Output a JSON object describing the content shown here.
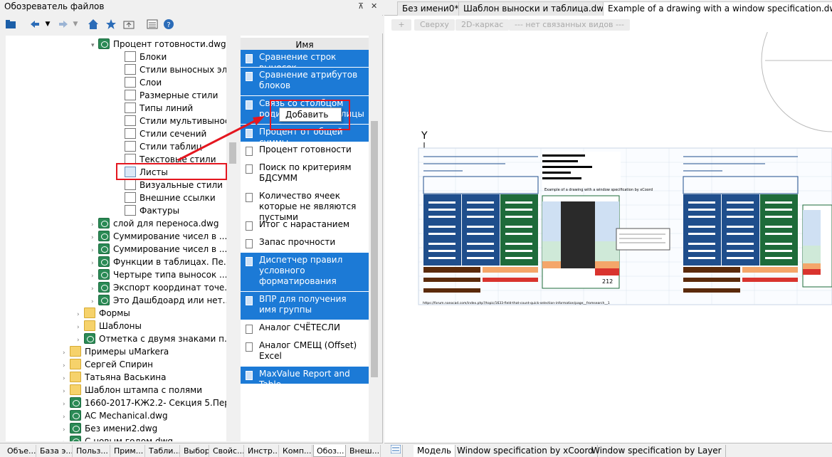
{
  "file_browser": {
    "title": "Обозреватель файлов",
    "pin_glyph": "⊼",
    "close_glyph": "✕"
  },
  "toolbar": {
    "icons": [
      "folder-icon",
      "back-icon",
      "forward-icon",
      "home-icon",
      "star-icon",
      "folder-up-icon",
      "view-icon",
      "help-icon"
    ]
  },
  "tree": [
    {
      "label": "Процент готовности.dwg",
      "icon": "dwg",
      "arrow": "▾",
      "indent": 128
    },
    {
      "label": "Блоки",
      "icon": "small",
      "indent": 165
    },
    {
      "label": "Стили выносных эл...",
      "icon": "small",
      "indent": 165
    },
    {
      "label": "Слои",
      "icon": "small",
      "indent": 165
    },
    {
      "label": "Размерные стили",
      "icon": "small",
      "indent": 165
    },
    {
      "label": "Типы линий",
      "icon": "small",
      "indent": 165
    },
    {
      "label": "Стили мультивыносок",
      "icon": "small",
      "indent": 165
    },
    {
      "label": "Стили сечений",
      "icon": "small",
      "indent": 165
    },
    {
      "label": "Стили таблиц",
      "icon": "small",
      "indent": 165
    },
    {
      "label": "Текстовые стили",
      "icon": "small",
      "indent": 165
    },
    {
      "label": "Листы",
      "icon": "sheet",
      "indent": 165
    },
    {
      "label": "Визуальные стили",
      "icon": "small",
      "indent": 165
    },
    {
      "label": "Внешние ссылки",
      "icon": "small",
      "indent": 165
    },
    {
      "label": "Фактуры",
      "icon": "small",
      "indent": 165
    },
    {
      "label": "слой для переноса.dwg",
      "icon": "dwg",
      "arrow": "›",
      "indent": 128
    },
    {
      "label": "Суммирование чисел в ...",
      "icon": "dwg",
      "arrow": "›",
      "indent": 128
    },
    {
      "label": "Суммирование чисел в ...",
      "icon": "dwg",
      "arrow": "›",
      "indent": 128
    },
    {
      "label": "Функции в таблицах. Пе...",
      "icon": "dwg",
      "arrow": "›",
      "indent": 128
    },
    {
      "label": "Чертыре типа выносок ...",
      "icon": "dwg",
      "arrow": "›",
      "indent": 128
    },
    {
      "label": "Экспорт координат точе...",
      "icon": "dwg",
      "arrow": "›",
      "indent": 128
    },
    {
      "label": "Это Дашбдоард или нет...",
      "icon": "dwg",
      "arrow": "›",
      "indent": 128
    },
    {
      "label": "Формы",
      "icon": "folder",
      "arrow": "›",
      "indent": 108
    },
    {
      "label": "Шаблоны",
      "icon": "folder",
      "arrow": "›",
      "indent": 108
    },
    {
      "label": "Отметка с двумя знаками п...",
      "icon": "dwg",
      "arrow": "›",
      "indent": 108
    },
    {
      "label": "Примеры uMarkera",
      "icon": "folder",
      "arrow": "›",
      "indent": 88
    },
    {
      "label": "Сергей Спирин",
      "icon": "folder",
      "arrow": "›",
      "indent": 88
    },
    {
      "label": "Татьяна Васькина",
      "icon": "folder",
      "arrow": "›",
      "indent": 88
    },
    {
      "label": "Шаблон штампа с полями",
      "icon": "folder",
      "arrow": "›",
      "indent": 88
    },
    {
      "label": "1660-2017-КЖ2.2- Секция 5.Пер...",
      "icon": "dwg",
      "arrow": "›",
      "indent": 88
    },
    {
      "label": "AC Mechanical.dwg",
      "icon": "dwg",
      "arrow": "›",
      "indent": 88
    },
    {
      "label": "Без имени2.dwg",
      "icon": "dwg",
      "arrow": "›",
      "indent": 88
    },
    {
      "label": "С новым годом.dwg",
      "icon": "dwg",
      "arrow": "›",
      "indent": 88
    }
  ],
  "list": {
    "header": "Имя",
    "items": [
      {
        "label": "Сравнение строк выносок",
        "selected": true,
        "lines": 1
      },
      {
        "label": "Сравнение атрибутов блоков",
        "selected": true,
        "lines": 2
      },
      {
        "label": "Связь со столбцом родительской таблицы",
        "selected": true,
        "lines": 2
      },
      {
        "label": "Процент от общей суммы",
        "selected": true,
        "lines": 1
      },
      {
        "label": "Процент готовности",
        "selected": false,
        "lines": 1
      },
      {
        "label": "Поиск по критериям БДСУММ",
        "selected": false,
        "lines": 2
      },
      {
        "label": "Количество ячеек которые не являются пустыми",
        "selected": false,
        "lines": 2
      },
      {
        "label": "Итог с нарастанием",
        "selected": false,
        "lines": 1
      },
      {
        "label": "Запас прочности",
        "selected": false,
        "lines": 1
      },
      {
        "label": "Диспетчер правил условного форматирования",
        "selected": true,
        "lines": 3
      },
      {
        "label": "ВПР для получения имя группы",
        "selected": true,
        "lines": 2
      },
      {
        "label": "Аналог СЧЁТЕСЛИ",
        "selected": false,
        "lines": 1
      },
      {
        "label": "Аналог СМЕЩ (Offset) Excel",
        "selected": false,
        "lines": 2
      },
      {
        "label": "MaxValue Report and Table",
        "selected": true,
        "lines": 1
      }
    ]
  },
  "context_menu": {
    "add_label": "Добавить"
  },
  "bottom_tabs": [
    "Объе...",
    "База э...",
    "Польз...",
    "Прим...",
    "Табли...",
    "Выбор",
    "Свойс...",
    "Инстр...",
    "Комп...",
    "Обоз...",
    "Внеш..."
  ],
  "bottom_active": 9,
  "doc_tabs": [
    {
      "label": "Без имени0*",
      "active": false
    },
    {
      "label": "Шаблон выноски и таблица.dwg*",
      "active": false
    },
    {
      "label": "Example of a drawing with a window specification.dwg*",
      "active": true
    }
  ],
  "view_buttons": [
    "+",
    "Сверху",
    "2D-каркас",
    "--- нет связанных видов ---"
  ],
  "layout_tabs": [
    {
      "label": "Модель",
      "active": true
    },
    {
      "label": "Window specification by xCoord",
      "active": false
    },
    {
      "label": "Window specification by Layer",
      "active": false
    }
  ],
  "drawing": {
    "axis_label": "Y",
    "url_text": "https://forum.nanocad.com/index.php?/topic/1633-field-that-count-quick-selection-information/page__fromsearch__1",
    "left_block_title": "Example of a drawing with a window specification by xCoord",
    "total_windows": "212",
    "colors": {
      "blue": "#1f4e8c",
      "green": "#1e6b3a",
      "cyan": "#5aa9c8",
      "red": "#d9332e",
      "orange": "#f4a66a",
      "brown": "#5b2a0a"
    }
  },
  "colors": {
    "selection": "#1c7ad6",
    "highlight": "#e4161f"
  }
}
